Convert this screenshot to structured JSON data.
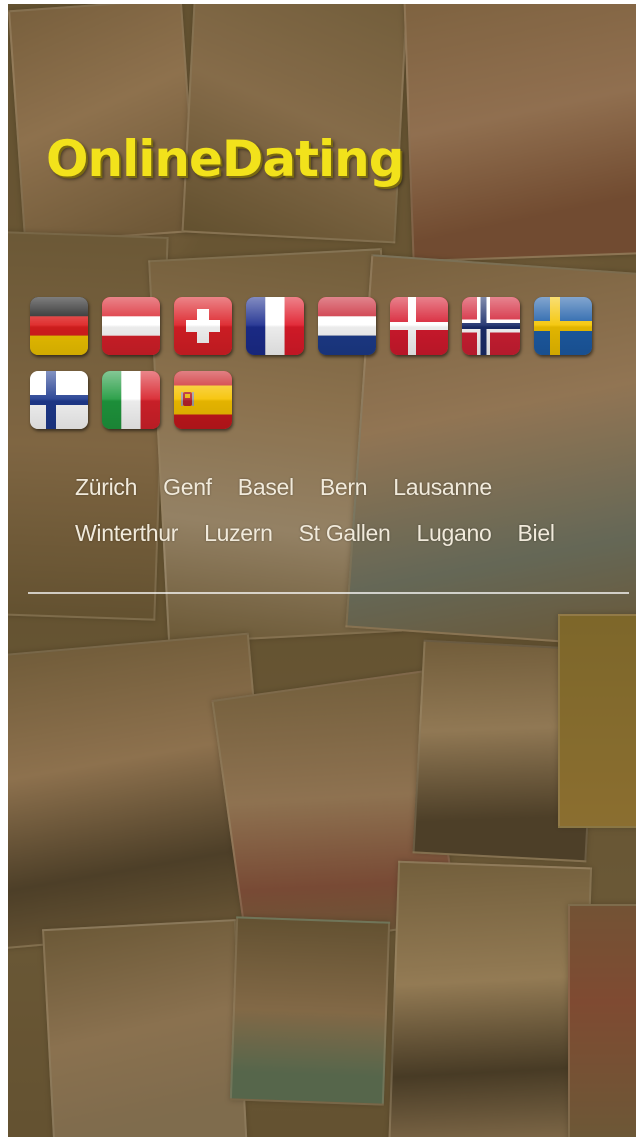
{
  "brand": {
    "logo_text": "OnlineDating",
    "logo_color": "#f2e21b"
  },
  "countries": [
    {
      "name": "germany",
      "icon": "flag-germany"
    },
    {
      "name": "austria",
      "icon": "flag-austria"
    },
    {
      "name": "switzerland",
      "icon": "flag-switzerland"
    },
    {
      "name": "france",
      "icon": "flag-france"
    },
    {
      "name": "netherlands",
      "icon": "flag-netherlands"
    },
    {
      "name": "denmark",
      "icon": "flag-denmark"
    },
    {
      "name": "norway",
      "icon": "flag-norway"
    },
    {
      "name": "sweden",
      "icon": "flag-sweden"
    },
    {
      "name": "finland",
      "icon": "flag-finland"
    },
    {
      "name": "italy",
      "icon": "flag-italy"
    },
    {
      "name": "spain",
      "icon": "flag-spain"
    }
  ],
  "cities": {
    "row1": [
      "Zürich",
      "Genf",
      "Basel",
      "Bern",
      "Lausanne"
    ],
    "row2": [
      "Winterthur",
      "Luzern",
      "St Gallen",
      "Lugano",
      "Biel"
    ]
  },
  "colors": {
    "background": "#736140",
    "link_text": "#f1eadb",
    "divider": "#ffffff"
  }
}
